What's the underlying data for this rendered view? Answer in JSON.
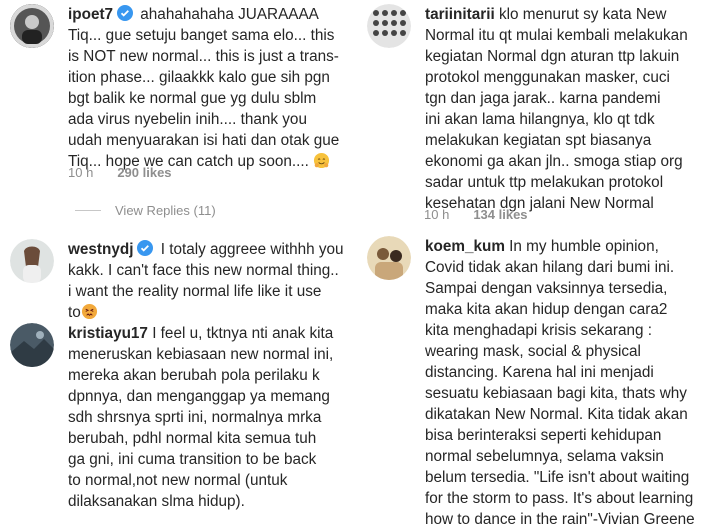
{
  "left": {
    "c1": {
      "username": "ipoet7",
      "text": "ahahahahaha JUARAAAA\nTiq... gue setuju banget sama elo... this\nis NOT new normal... this is just a trans-\nition phase... gilaakkk kalo gue sih pgn\nbgt balik ke normal gue yg dulu sblm\nada virus nyebelin inih.... thank you\nudah menyuarakan isi hati dan otak gue\nTiq... hope we can catch up soon....",
      "time": "10 h",
      "likes": "290 likes",
      "replies": "View Replies (11)",
      "emoji": "hugging-face"
    },
    "c2": {
      "username": "westnydj",
      "text": "I totaly aggreee withhh you\nkakk. I can't face this new normal thing..\ni want the reality normal life like it use\nto",
      "emoji": "persevering-face"
    },
    "c3": {
      "username": "kristiayu17",
      "text": "I feel u, tktnya nti anak kita\nmeneruskan kebiasaan new normal ini,\nmereka akan berubah pola perilaku k\ndpnnya, dan menganggap ya memang\nsdh shrsnya sprti ini, normalnya mrka\nberubah, pdhl normal kita semua tuh\nga gni, ini cuma transition to be back\nto normal,not new normal (untuk\ndilaksanakan slma hidup)."
    }
  },
  "right": {
    "c1": {
      "username": "tariinitarii",
      "text": "klo menurut sy kata New\nNormal itu qt mulai kembali melakukan\nkegiatan Normal dgn aturan ttp lakuin\nprotokol menggunakan masker, cuci\ntgn dan jaga jarak.. karna pandemi\nini akan lama hilangnya, klo qt tdk\nmelakukan kegiatan spt biasanya\nekonomi ga akan jln.. smoga stiap org\nsadar untuk ttp melakukan protokol\nkesehatan dgn jalani New Normal",
      "time": "10 h",
      "likes": "134 likes"
    },
    "c2": {
      "username": "koem_kum",
      "text": "In my humble opinion,\nCovid tidak akan hilang dari bumi ini.\nSampai dengan vaksinnya tersedia,\nmaka kita akan hidup dengan cara2\nkita menghadapi krisis sekarang :\nwearing mask, social & physical\ndistancing. Karena hal ini menjadi\nsesuatu kebiasaan bagi kita, thats why\ndikatakan New Normal. Kita tidak akan\nbisa berinteraksi seperti kehidupan\nnormal sebelumnya, selama vaksin\nbelum tersedia. \"Life isn't about waiting\nfor the storm to pass. It's about learning\nhow to dance in the rain\"-Vivian Greene"
    }
  },
  "colors": {
    "verified": "#3897f0",
    "meta": "#8e8e8e",
    "text": "#262626"
  }
}
